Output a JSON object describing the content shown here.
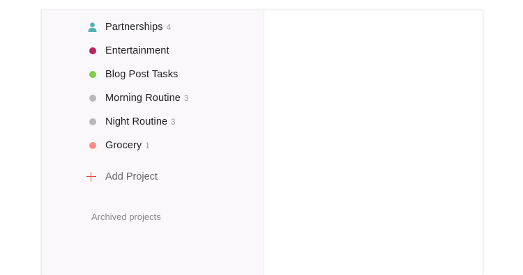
{
  "sidebar": {
    "projects": [
      {
        "name": "Partnerships",
        "count": "4",
        "icon": "person-icon",
        "color": "#4fb3b2"
      },
      {
        "name": "Entertainment",
        "count": "",
        "icon": "dot",
        "color": "#b8255f"
      },
      {
        "name": "Blog Post Tasks",
        "count": "",
        "icon": "dot",
        "color": "#7ecc49"
      },
      {
        "name": "Morning Routine",
        "count": "3",
        "icon": "dot",
        "color": "#b8b8b8"
      },
      {
        "name": "Night Routine",
        "count": "3",
        "icon": "dot",
        "color": "#b8b8b8"
      },
      {
        "name": "Grocery",
        "count": "1",
        "icon": "dot",
        "color": "#ff8d85"
      }
    ],
    "add_project_label": "Add Project",
    "archived_label": "Archived projects"
  }
}
